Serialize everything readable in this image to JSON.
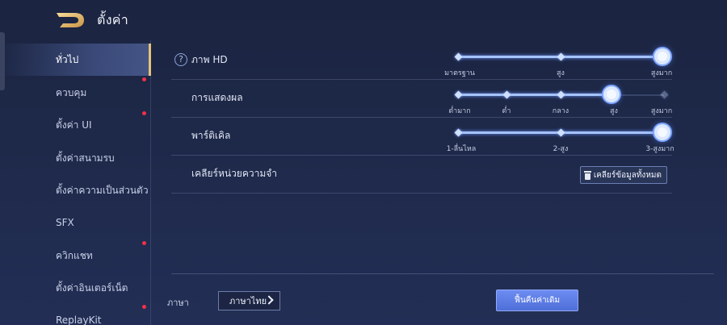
{
  "header": {
    "title": "ตั้งค่า",
    "logo_icon": "back-arrow-icon",
    "accent_color": "#e8c27a"
  },
  "sidebar": {
    "items": [
      {
        "label": "ทั่วไป",
        "active": true,
        "badge": false
      },
      {
        "label": "ควบคุม",
        "active": false,
        "badge": true
      },
      {
        "label": "ตั้งค่า UI",
        "active": false,
        "badge": true
      },
      {
        "label": "ตั้งค่าสนามรบ",
        "active": false,
        "badge": false
      },
      {
        "label": "ตั้งค่าความเป็นส่วนตัว",
        "active": false,
        "badge": false
      },
      {
        "label": "SFX",
        "active": false,
        "badge": false
      },
      {
        "label": "ควิกแชท",
        "active": false,
        "badge": true
      },
      {
        "label": "ตั้งค่าอินเตอร์เน็ต",
        "active": false,
        "badge": false
      },
      {
        "label": "ReplayKit",
        "active": false,
        "badge": true
      }
    ]
  },
  "settings": {
    "graphics": {
      "label": "ภาพ HD",
      "help_icon": "?",
      "options": [
        "มาตรฐาน",
        "สูง",
        "สูงมาก"
      ],
      "selected_index": 2
    },
    "display": {
      "label": "การแสดงผล",
      "options": [
        "ต่ำมาก",
        "ต่ำ",
        "กลาง",
        "สูง",
        "สูงมาก"
      ],
      "selected_index": 3
    },
    "particles": {
      "label": "พาร์ติเคิล",
      "options": [
        "1-ลื่นไหล",
        "2-สูง",
        "3-สูงมาก"
      ],
      "selected_index": 2
    },
    "memory": {
      "label": "เคลียร์หน่วยความจำ",
      "button_label": "เคลียร์ข้อมูลทั้งหมด",
      "button_icon": "trash-icon"
    }
  },
  "footer": {
    "language_label": "ภาษา",
    "language_value": "ภาษาไทย",
    "reset_label": "ฟื้นคืนค่าเดิม"
  }
}
